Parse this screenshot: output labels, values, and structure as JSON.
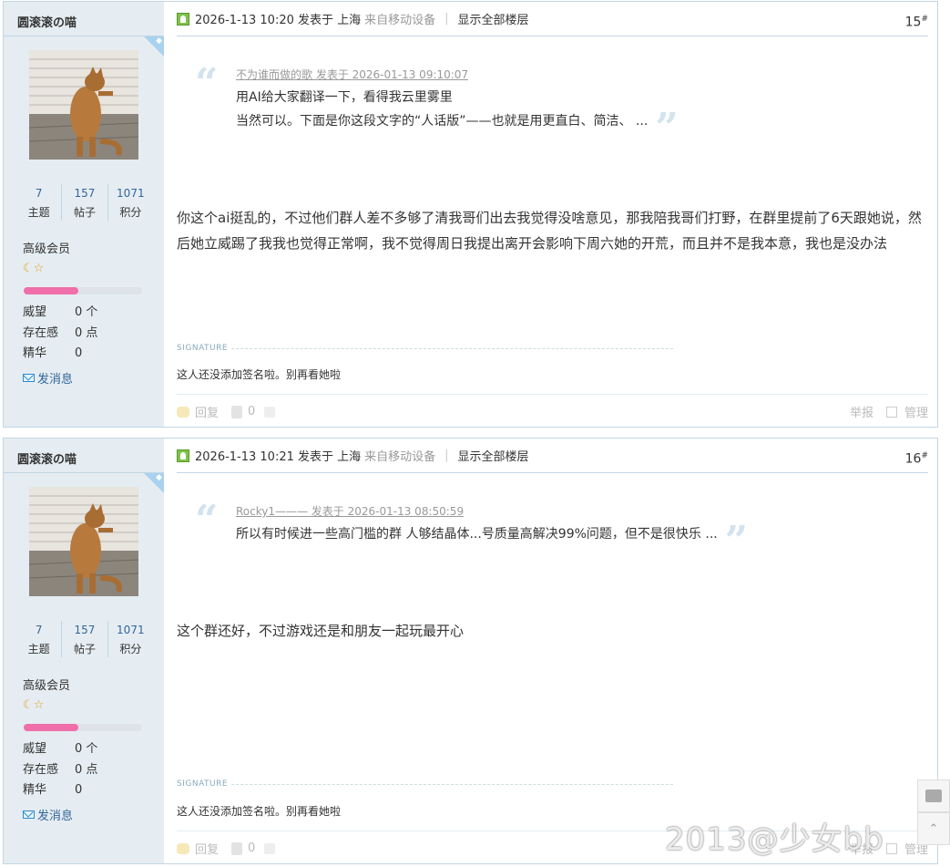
{
  "posts": [
    {
      "username": "圆滚滚の喵",
      "stats": [
        {
          "num": "7",
          "label": "主题"
        },
        {
          "num": "157",
          "label": "帖子"
        },
        {
          "num": "1071",
          "label": "积分"
        }
      ],
      "level": "高级会员",
      "stars": "🌙⭐",
      "progress_fraction": 0.46,
      "meta": [
        {
          "key": "威望",
          "value": "0 个"
        },
        {
          "key": "存在感",
          "value": "0 点"
        },
        {
          "key": "精华",
          "value": "0"
        }
      ],
      "pm_label": "发消息",
      "datetime": "2026-1-13 10:20 发表于 上海",
      "device": "来自移动设备",
      "show_all": "显示全部楼层",
      "floor": "15",
      "quote": {
        "by": "不为谁而做的歌 发表于 2026-01-13 09:10:07",
        "lines": [
          "用AI给大家翻译一下，看得我云里雾里",
          "当然可以。下面是你这段文字的“人话版”——也就是用更直白、简洁、 ..."
        ]
      },
      "message": "你这个ai挺乱的，不过他们群人差不多够了清我哥们出去我觉得没啥意见，那我陪我哥们打野，在群里提前了6天跟她说，然后她立威踢了我我也觉得正常啊，我不觉得周日我提出离开会影响下周六她的开荒，而且并不是我本意，我也是没办法",
      "signature_label": "SIGNATURE",
      "signature": "这人还没添加签名啦。别再看她啦",
      "reply_label": "回复",
      "vote_count": "0",
      "report_label": "举报",
      "manage_label": "管理"
    },
    {
      "username": "圆滚滚の喵",
      "stats": [
        {
          "num": "7",
          "label": "主题"
        },
        {
          "num": "157",
          "label": "帖子"
        },
        {
          "num": "1071",
          "label": "积分"
        }
      ],
      "level": "高级会员",
      "stars": "🌙⭐",
      "progress_fraction": 0.46,
      "meta": [
        {
          "key": "威望",
          "value": "0 个"
        },
        {
          "key": "存在感",
          "value": "0 点"
        },
        {
          "key": "精华",
          "value": "0"
        }
      ],
      "pm_label": "发消息",
      "datetime": "2026-1-13 10:21 发表于 上海",
      "device": "来自移动设备",
      "show_all": "显示全部楼层",
      "floor": "16",
      "quote": {
        "by": "Rocky1——— 发表于 2026-01-13 08:50:59",
        "lines": [
          "所以有时候进一些高门槛的群 人够结晶体...号质量高解决99%问题，但不是很快乐 ..."
        ]
      },
      "message": "这个群还好，不过游戏还是和朋友一起玩最开心",
      "signature_label": "SIGNATURE",
      "signature": "这人还没添加签名啦。别再看她啦",
      "reply_label": "回复",
      "vote_count": "0",
      "report_label": "举报",
      "manage_label": "管理"
    }
  ],
  "watermark": "2013@少女bb",
  "floor_mark": "#",
  "colors": {
    "border": "#c2d5e3",
    "sidebar_bg": "#e5edf2",
    "link": "#336699",
    "progress": "#f06ea9"
  }
}
